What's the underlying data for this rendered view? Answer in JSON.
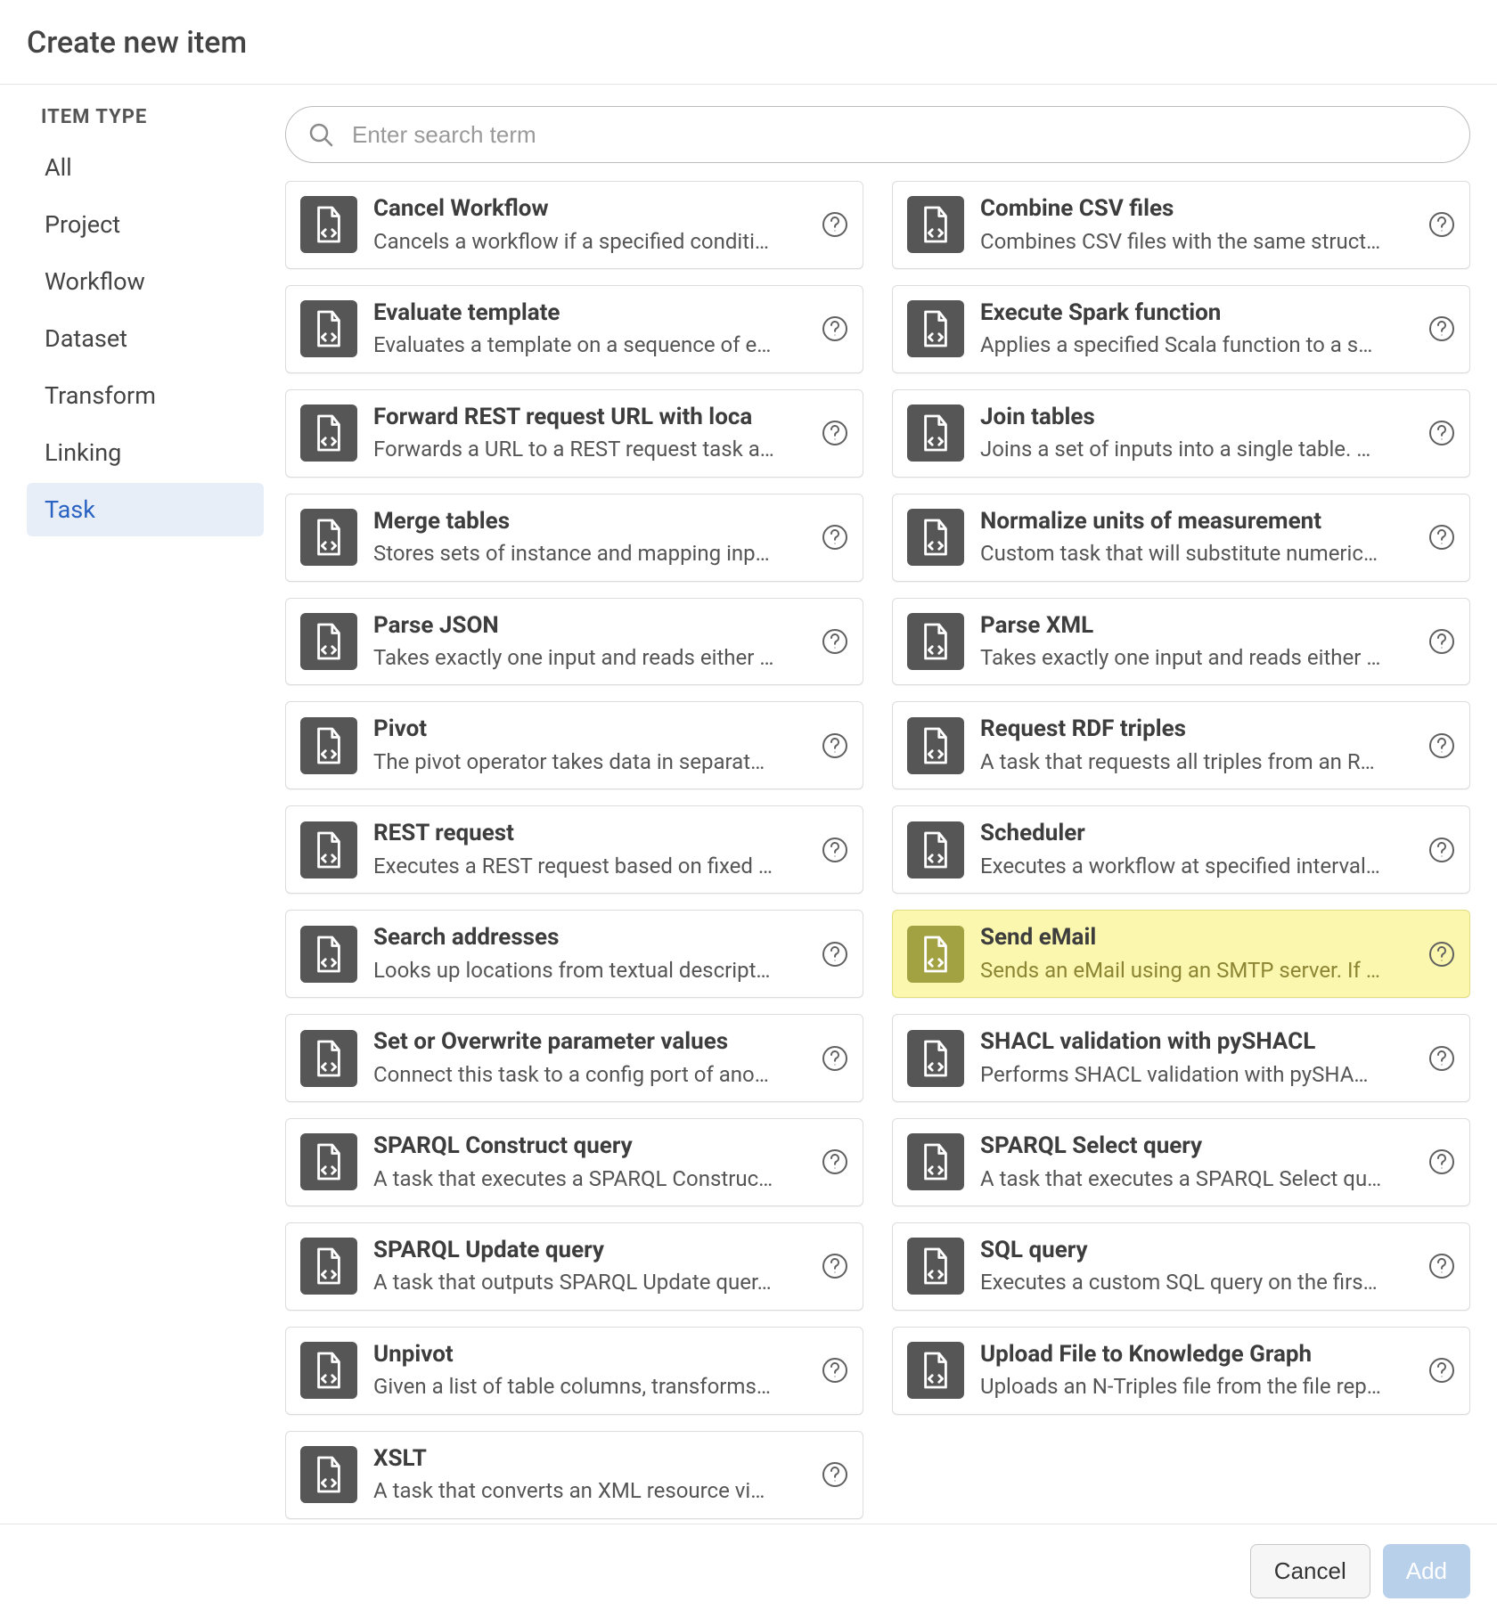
{
  "header": {
    "title": "Create new item"
  },
  "sidebar": {
    "heading": "ITEM TYPE",
    "items": [
      {
        "label": "All"
      },
      {
        "label": "Project"
      },
      {
        "label": "Workflow"
      },
      {
        "label": "Dataset"
      },
      {
        "label": "Transform"
      },
      {
        "label": "Linking"
      },
      {
        "label": "Task"
      }
    ],
    "active_index": 6
  },
  "search": {
    "placeholder": "Enter search term",
    "value": ""
  },
  "footer": {
    "cancel_label": "Cancel",
    "add_label": "Add"
  },
  "items": {
    "left": [
      {
        "title": "Cancel Workflow",
        "desc": "Cancels a workflow if a specified conditi…"
      },
      {
        "title": "Evaluate template",
        "desc": "Evaluates a template on a sequence of e…"
      },
      {
        "title": "Forward REST request URL with loca",
        "desc": "Forwards a URL to a REST request task a…"
      },
      {
        "title": "Merge tables",
        "desc": "Stores sets of instance and mapping inp…"
      },
      {
        "title": "Parse JSON",
        "desc": "Takes exactly one input and reads either …"
      },
      {
        "title": "Pivot",
        "desc": "The pivot operator takes data in separat…"
      },
      {
        "title": "REST request",
        "desc": "Executes a REST request based on fixed …"
      },
      {
        "title": "Search addresses",
        "desc": "Looks up locations from textual descript…"
      },
      {
        "title": "Set or Overwrite parameter values",
        "desc": "Connect this task to a config port of ano…"
      },
      {
        "title": "SPARQL Construct query",
        "desc": "A task that executes a SPARQL Construc…"
      },
      {
        "title": "SPARQL Update query",
        "desc": "A task that outputs SPARQL Update quer…"
      },
      {
        "title": "Unpivot",
        "desc": "Given a list of table columns, transforms…"
      },
      {
        "title": "XSLT",
        "desc": "A task that converts an XML resource vi…"
      }
    ],
    "right": [
      {
        "title": "Combine CSV files",
        "desc": "Combines CSV files with the same struct…"
      },
      {
        "title": "Execute Spark function",
        "desc": "Applies a specified Scala function to a s…"
      },
      {
        "title": "Join tables",
        "desc": "Joins a set of inputs into a single table. …"
      },
      {
        "title": "Normalize units of measurement",
        "desc": "Custom task that will substitute numeric…"
      },
      {
        "title": "Parse XML",
        "desc": "Takes exactly one input and reads either …"
      },
      {
        "title": "Request RDF triples",
        "desc": "A task that requests all triples from an R…"
      },
      {
        "title": "Scheduler",
        "desc": "Executes a workflow at specified interval…"
      },
      {
        "title": "Send eMail",
        "desc": "Sends an eMail using an SMTP server. If …",
        "highlight": true
      },
      {
        "title": "SHACL validation with pySHACL",
        "desc": "Performs SHACL validation with pySHA…"
      },
      {
        "title": "SPARQL Select query",
        "desc": "A task that executes a SPARQL Select qu…"
      },
      {
        "title": "SQL query",
        "desc": "Executes a custom SQL query on the firs…"
      },
      {
        "title": "Upload File to Knowledge Graph",
        "desc": "Uploads an N-Triples file from the file rep…"
      }
    ]
  }
}
